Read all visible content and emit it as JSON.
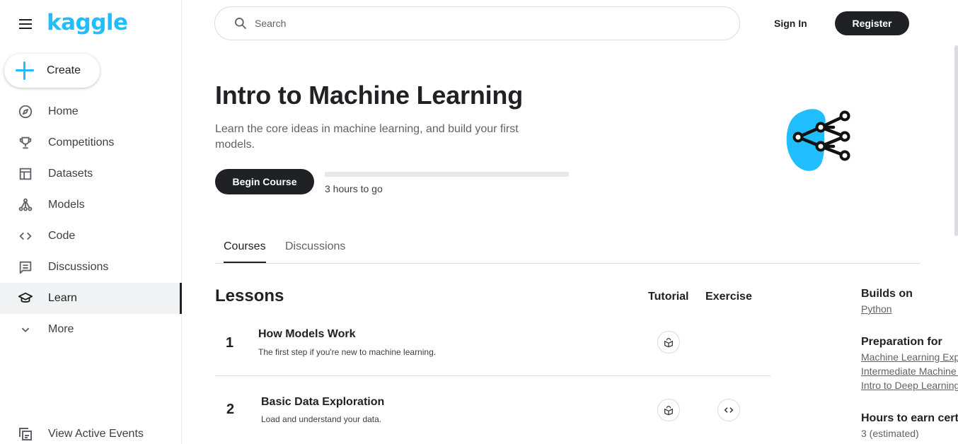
{
  "sidebar": {
    "logo": "kaggle",
    "create_label": "Create",
    "items": [
      {
        "label": "Home",
        "icon": "compass-icon"
      },
      {
        "label": "Competitions",
        "icon": "trophy-icon"
      },
      {
        "label": "Datasets",
        "icon": "table-icon"
      },
      {
        "label": "Models",
        "icon": "models-icon"
      },
      {
        "label": "Code",
        "icon": "code-icon"
      },
      {
        "label": "Discussions",
        "icon": "comment-icon"
      },
      {
        "label": "Learn",
        "icon": "school-icon",
        "active": true
      },
      {
        "label": "More",
        "icon": "chevron-down-icon"
      }
    ],
    "events_label": "View Active Events"
  },
  "header": {
    "search_placeholder": "Search",
    "signin_label": "Sign In",
    "register_label": "Register"
  },
  "course": {
    "title": "Intro to Machine Learning",
    "subtitle": "Learn the core ideas in machine learning, and build your first models.",
    "begin_label": "Begin Course",
    "progress_fraction": 0,
    "progress_text": "3 hours to go"
  },
  "tabs": [
    {
      "label": "Courses",
      "active": true
    },
    {
      "label": "Discussions",
      "active": false
    }
  ],
  "lessons": {
    "heading": "Lessons",
    "col_tutorial": "Tutorial",
    "col_exercise": "Exercise",
    "rows": [
      {
        "num": "1",
        "name": "How Models Work",
        "desc": "The first step if you're new to machine learning.",
        "tutorial": true,
        "exercise": false
      },
      {
        "num": "2",
        "name": "Basic Data Exploration",
        "desc": "Load and understand your data.",
        "tutorial": true,
        "exercise": true
      }
    ]
  },
  "right_panel": {
    "builds_on_heading": "Builds on",
    "builds_on": [
      "Python"
    ],
    "prep_heading": "Preparation for",
    "prep_links": [
      "Machine Learning Explainability",
      "Intermediate Machine Learning",
      "Intro to Deep Learning"
    ],
    "hours_heading": "Hours to earn certificate",
    "hours_value": "3 (estimated)"
  },
  "colors": {
    "brand": "#20beff",
    "dark": "#202124"
  }
}
